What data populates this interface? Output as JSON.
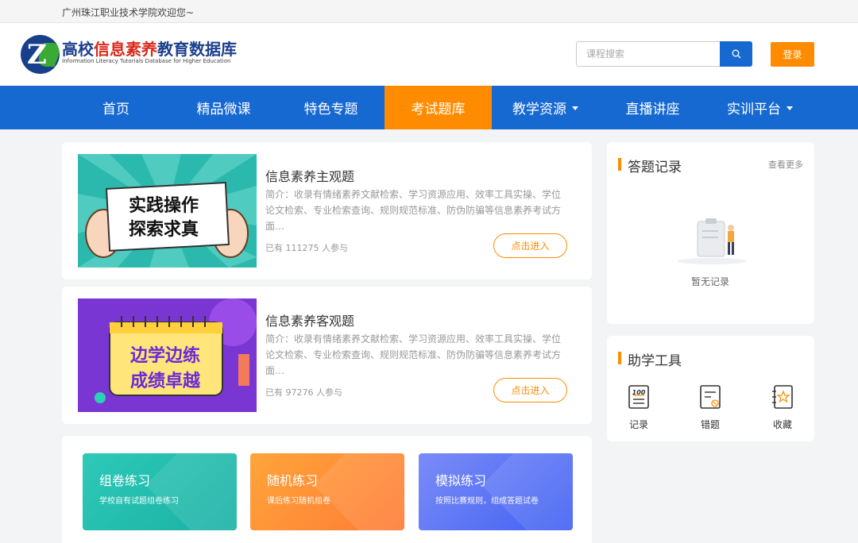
{
  "topbar": {
    "welcome": "广州珠江职业技术学院欢迎您~"
  },
  "logo": {
    "title_part1": "高校",
    "title_part2": "信息素养",
    "title_part3": "教育数据库",
    "subtitle": "Information Literacy Tutorials Database for Higher Education"
  },
  "search": {
    "placeholder": "课程搜索"
  },
  "login": {
    "label": "登录"
  },
  "nav": {
    "items": [
      {
        "label": "首页"
      },
      {
        "label": "精品微课"
      },
      {
        "label": "特色专题"
      },
      {
        "label": "考试题库"
      },
      {
        "label": "教学资源"
      },
      {
        "label": "直播讲座"
      },
      {
        "label": "实训平台"
      }
    ],
    "active_index": 3
  },
  "courses": [
    {
      "img_line1": "实践操作",
      "img_line2": "探索求真",
      "title": "信息素养主观题",
      "desc": "简介：收录有情绪素养文献检索、学习资源应用、效率工具实操、学位论文检索、专业检索查询、规则规范标准、防伪防骗等信息素养考试方面…",
      "count": "已有 111275 人参与",
      "button": "点击进入"
    },
    {
      "img_line1": "边学边练",
      "img_line2": "成绩卓越",
      "title": "信息素养客观题",
      "desc": "简介：收录有情绪素养文献检索、学习资源应用、效率工具实操、学位论文检索、专业检索查询、规则规范标准、防伪防骗等信息素养考试方面…",
      "count": "已有 97276 人参与",
      "button": "点击进入"
    }
  ],
  "practice": [
    {
      "title": "组卷练习",
      "subtitle": "学校自有试题组卷练习"
    },
    {
      "title": "随机练习",
      "subtitle": "课后练习随机组卷"
    },
    {
      "title": "模拟练习",
      "subtitle": "按照比赛规则，组成答题试卷"
    }
  ],
  "records": {
    "title": "答题记录",
    "more": "查看更多",
    "empty": "暂无记录"
  },
  "tools": {
    "title": "助学工具",
    "items": [
      {
        "label": "记录",
        "icon": "score-100-icon"
      },
      {
        "label": "错题",
        "icon": "wrong-question-icon"
      },
      {
        "label": "收藏",
        "icon": "favorite-star-icon"
      }
    ]
  },
  "colors": {
    "primary": "#1769d2",
    "accent": "#ff8c00"
  }
}
